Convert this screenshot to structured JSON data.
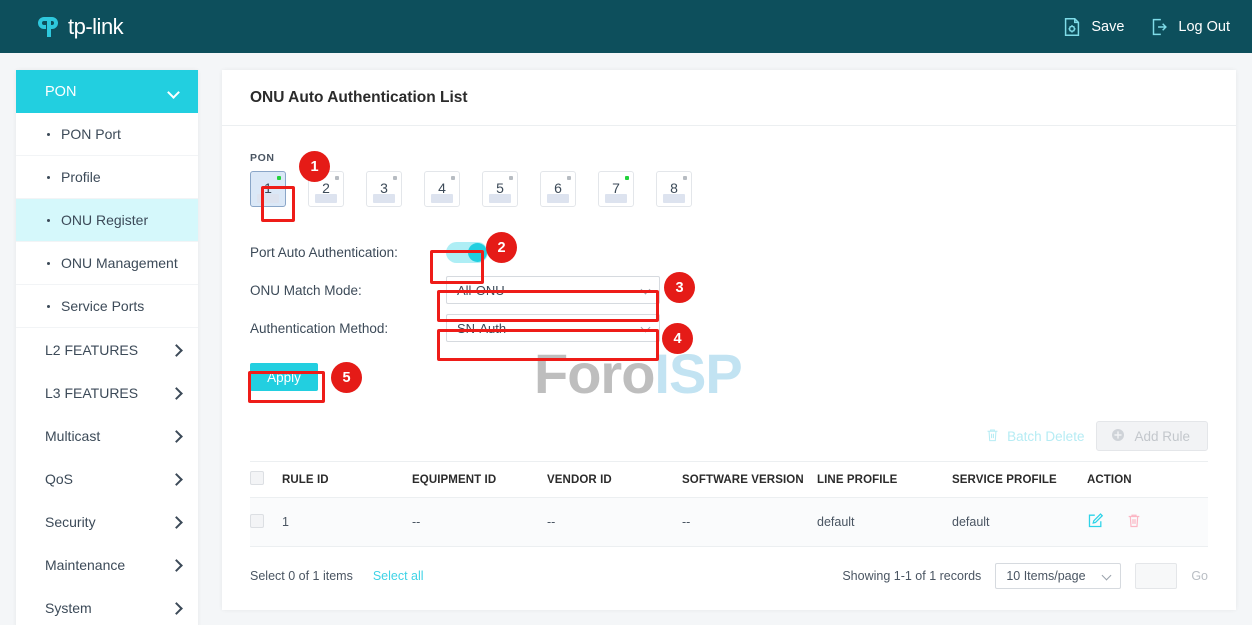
{
  "header": {
    "brand": "tp-link",
    "save_label": "Save",
    "logout_label": "Log Out",
    "save_icon": "save-document-gear-icon",
    "logout_icon": "logout-arrow-icon",
    "bg_color": "#0d4f5c"
  },
  "sidebar": {
    "group": {
      "label": "PON",
      "icon": "chevron-down-icon",
      "color": "#22cfe0"
    },
    "sub_items": [
      {
        "label": "PON Port",
        "active": false
      },
      {
        "label": "Profile",
        "active": false
      },
      {
        "label": "ONU Register",
        "active": true
      },
      {
        "label": "ONU Management",
        "active": false
      },
      {
        "label": "Service Ports",
        "active": false
      }
    ],
    "items": [
      {
        "label": "L2 FEATURES",
        "icon": "chevron-right-icon"
      },
      {
        "label": "L3 FEATURES",
        "icon": "chevron-right-icon"
      },
      {
        "label": "Multicast",
        "icon": "chevron-right-icon"
      },
      {
        "label": "QoS",
        "icon": "chevron-right-icon"
      },
      {
        "label": "Security",
        "icon": "chevron-right-icon"
      },
      {
        "label": "Maintenance",
        "icon": "chevron-right-icon"
      },
      {
        "label": "System",
        "icon": "chevron-right-icon"
      }
    ]
  },
  "main": {
    "title": "ONU Auto Authentication List",
    "watermark": {
      "part1": "Foro",
      "part2": "ISP"
    },
    "pon": {
      "label": "PON",
      "ports": [
        {
          "num": "1",
          "led": "on",
          "selected": true
        },
        {
          "num": "2",
          "led": "off",
          "selected": false
        },
        {
          "num": "3",
          "led": "off",
          "selected": false
        },
        {
          "num": "4",
          "led": "off",
          "selected": false
        },
        {
          "num": "5",
          "led": "off",
          "selected": false
        },
        {
          "num": "6",
          "led": "off",
          "selected": false
        },
        {
          "num": "7",
          "led": "on",
          "selected": false
        },
        {
          "num": "8",
          "led": "off",
          "selected": false
        }
      ]
    },
    "form": {
      "auto_auth_label": "Port Auto Authentication:",
      "auto_auth_state": "on",
      "match_mode_label": "ONU Match Mode:",
      "match_mode_value": "All-ONU",
      "auth_method_label": "Authentication Method:",
      "auth_method_value": "SN-Auth",
      "apply_label": "Apply"
    },
    "toolbar": {
      "batch_delete_label": "Batch Delete",
      "batch_delete_icon": "trash-icon",
      "add_rule_label": "Add Rule",
      "add_rule_icon": "plus-circle-icon"
    },
    "table": {
      "columns": [
        "RULE ID",
        "EQUIPMENT ID",
        "VENDOR ID",
        "SOFTWARE VERSION",
        "LINE PROFILE",
        "SERVICE PROFILE",
        "ACTION"
      ],
      "rows": [
        {
          "rule_id": "1",
          "equipment_id": "--",
          "vendor_id": "--",
          "software_version": "--",
          "line_profile": "default",
          "service_profile": "default",
          "edit_icon": "edit-pencil-icon",
          "delete_icon": "trash-icon"
        }
      ]
    },
    "footer": {
      "select_count": "Select 0 of 1 items",
      "select_all": "Select all",
      "showing": "Showing 1-1 of 1 records",
      "page_size": "10 Items/page",
      "jump_value": "",
      "go_label": "Go"
    }
  },
  "annotations": [
    {
      "number": "1"
    },
    {
      "number": "2"
    },
    {
      "number": "3"
    },
    {
      "number": "4"
    },
    {
      "number": "5"
    }
  ]
}
